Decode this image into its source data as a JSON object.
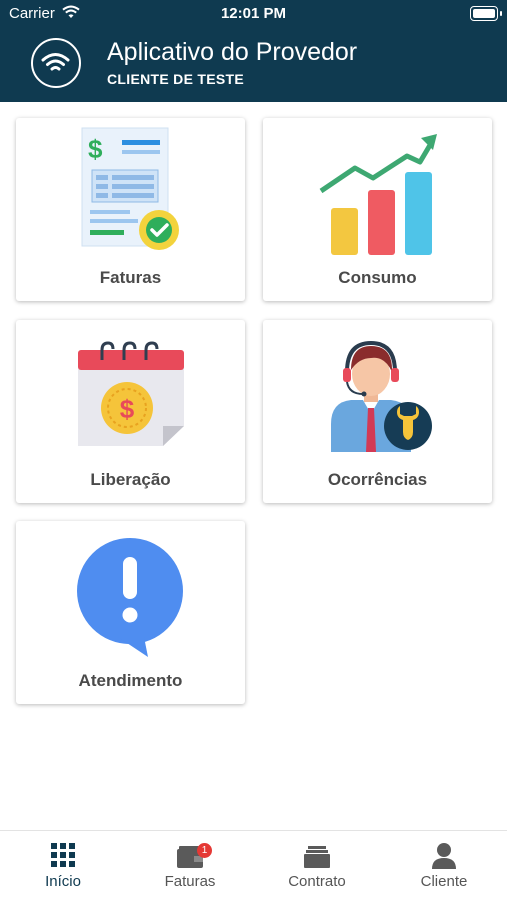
{
  "status_bar": {
    "carrier": "Carrier",
    "time": "12:01 PM"
  },
  "header": {
    "title": "Aplicativo do Provedor",
    "subtitle": "CLIENTE DE TESTE"
  },
  "menu": {
    "items": [
      {
        "label": "Faturas",
        "icon": "invoice-icon"
      },
      {
        "label": "Consumo",
        "icon": "bar-chart-icon"
      },
      {
        "label": "Liberação",
        "icon": "calendar-money-icon"
      },
      {
        "label": "Ocorrências",
        "icon": "support-agent-icon"
      },
      {
        "label": "Atendimento",
        "icon": "alert-bubble-icon"
      }
    ]
  },
  "tabs": [
    {
      "label": "Início",
      "icon": "grid-icon",
      "active": true
    },
    {
      "label": "Faturas",
      "icon": "wallet-icon",
      "badge": "1"
    },
    {
      "label": "Contrato",
      "icon": "folder-stack-icon"
    },
    {
      "label": "Cliente",
      "icon": "person-icon"
    }
  ],
  "colors": {
    "primary": "#0f3a50",
    "badge": "#e53935",
    "card_text": "#4a4a4a"
  }
}
